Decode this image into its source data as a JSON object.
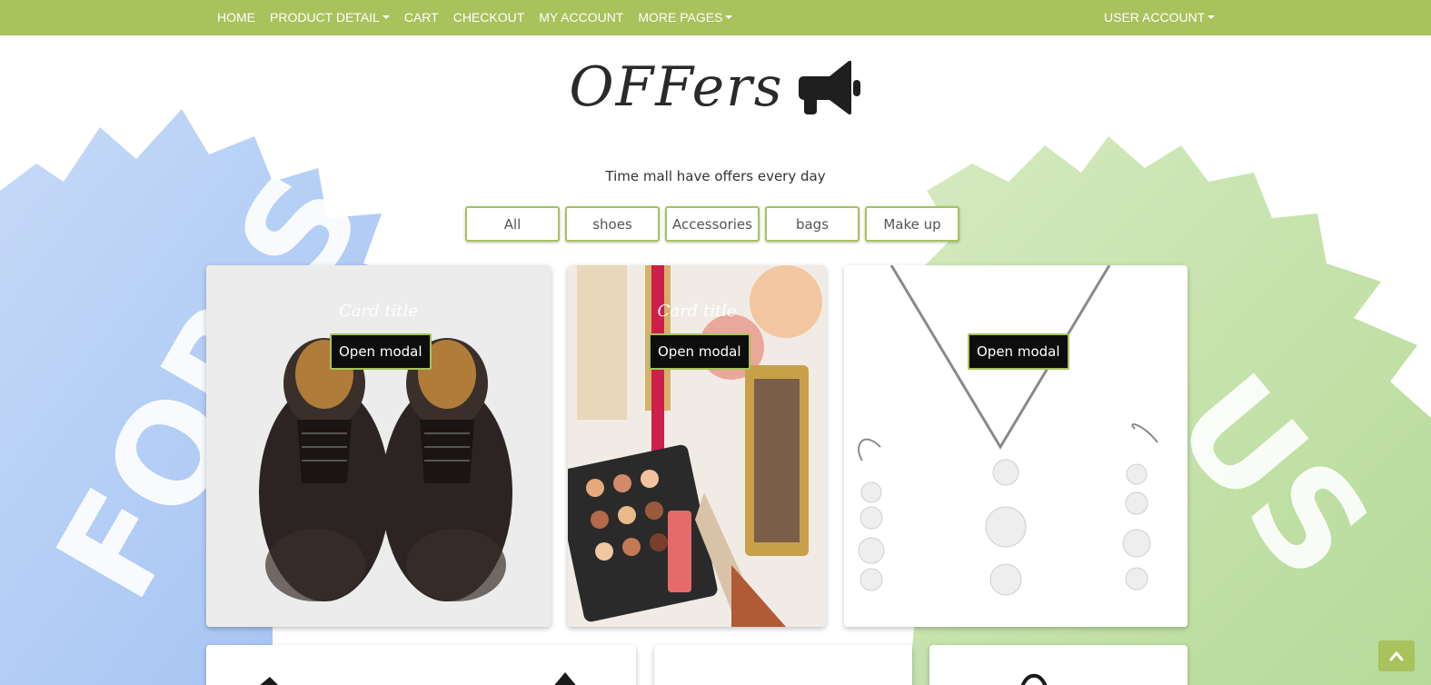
{
  "nav": {
    "items": [
      {
        "label": "HOME",
        "dropdown": false
      },
      {
        "label": "PRODUCT DETAIL",
        "dropdown": true
      },
      {
        "label": "CART",
        "dropdown": false
      },
      {
        "label": "CHECKOUT",
        "dropdown": false
      },
      {
        "label": "MY ACCOUNT",
        "dropdown": false
      },
      {
        "label": "MORE PAGES",
        "dropdown": true
      }
    ],
    "user_account": "USER ACCOUNT"
  },
  "header": {
    "title": "OFFers",
    "icon": "megaphone-icon",
    "tagline": "Time mall have offers every day"
  },
  "background": {
    "left_burst_text": "FOR SALE",
    "right_burst_text": "US"
  },
  "filters": [
    "All",
    "shoes",
    "Accessories",
    "bags",
    "Make up"
  ],
  "cards": [
    {
      "title": "Card title",
      "button": "Open modal",
      "image": "brogue-shoes"
    },
    {
      "title": "Card title",
      "button": "Open modal",
      "image": "makeup-cosmetics"
    },
    {
      "title": "",
      "button": "Open modal",
      "image": "pearl-jewelry"
    }
  ],
  "colors": {
    "accent": "#a8c25c",
    "button_dark": "#0d0d0d",
    "burst_blue": "#a6c6f5",
    "burst_green": "#b9dd9a"
  },
  "scroll_top_icon": "chevron-up-icon"
}
